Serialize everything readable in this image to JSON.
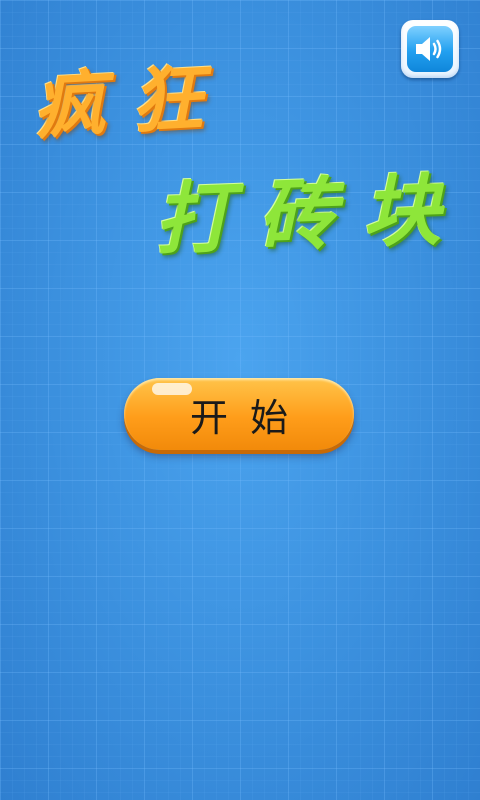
{
  "title": {
    "line1": "疯狂",
    "line2": "打砖块"
  },
  "sound_button": {
    "icon": "speaker-icon"
  },
  "start_button": {
    "label": "开始"
  },
  "colors": {
    "background": "#3f95e2",
    "title_line1": "#ffb02e",
    "title_line2": "#8ee63a",
    "start_button": "#ff9d1a",
    "sound_button": "#22a0f0"
  }
}
